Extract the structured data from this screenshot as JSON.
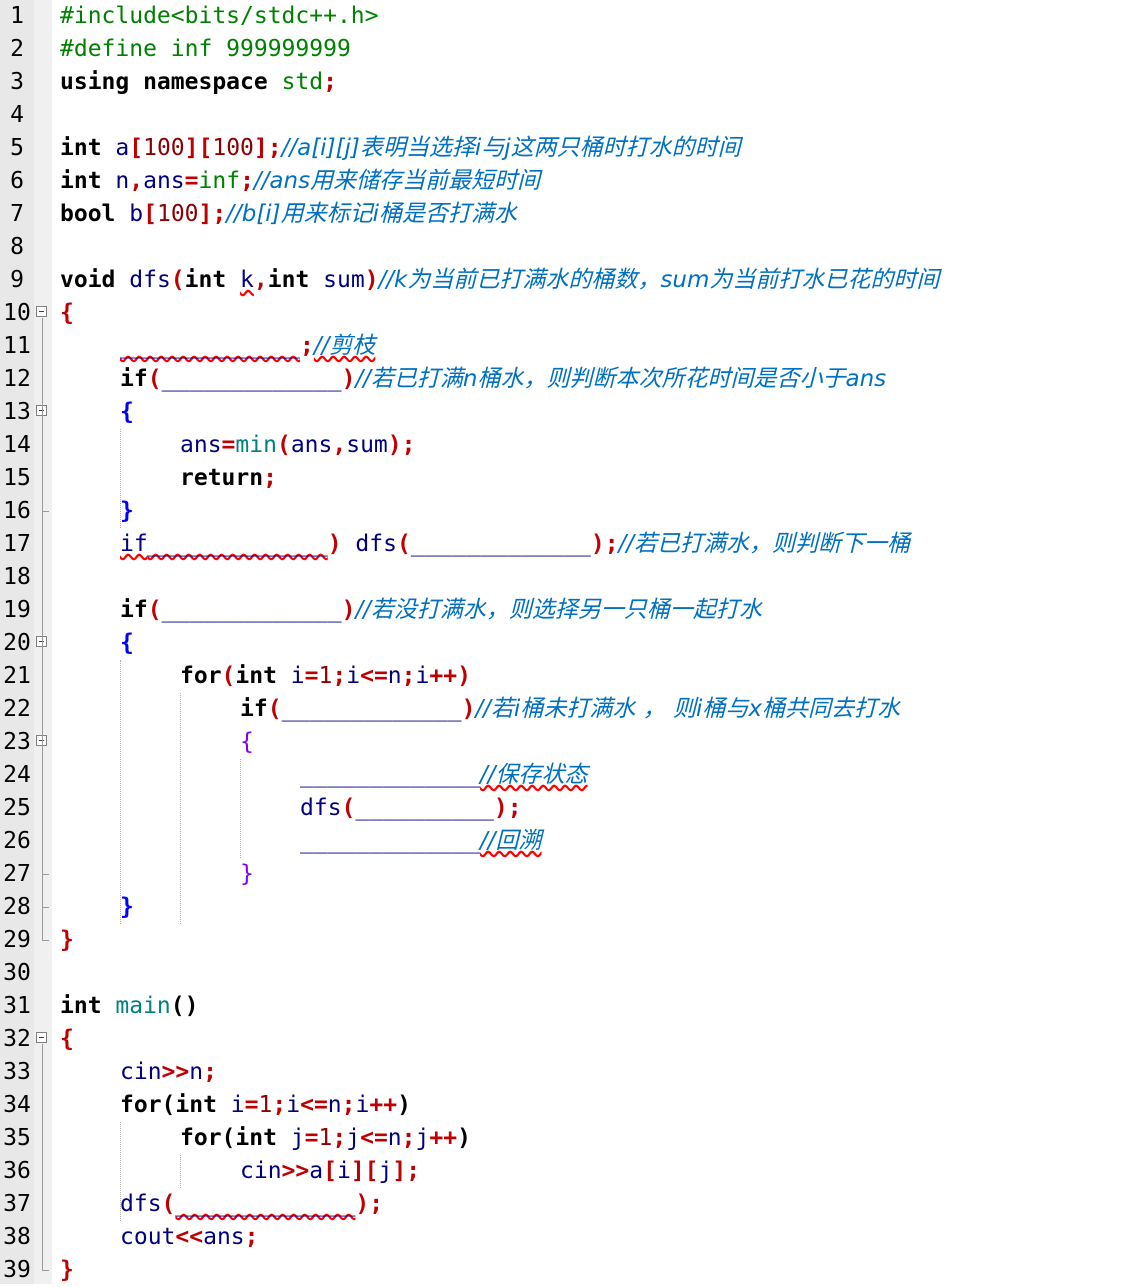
{
  "editor": {
    "lines": [
      {
        "n": "1",
        "indent": 0,
        "parts": [
          {
            "t": "#include<bits/stdc++.h>",
            "c": "pp"
          }
        ]
      },
      {
        "n": "2",
        "indent": 0,
        "parts": [
          {
            "t": "#define inf 999999999",
            "c": "pp"
          }
        ]
      },
      {
        "n": "3",
        "indent": 0,
        "parts": [
          {
            "t": "using namespace ",
            "c": "kw"
          },
          {
            "t": "std",
            "c": "pp"
          },
          {
            "t": ";",
            "c": "op"
          }
        ]
      },
      {
        "n": "4",
        "indent": 0,
        "parts": []
      },
      {
        "n": "5",
        "indent": 0,
        "parts": [
          {
            "t": "int ",
            "c": "kw"
          },
          {
            "t": "a",
            "c": "id"
          },
          {
            "t": "[",
            "c": "op"
          },
          {
            "t": "100",
            "c": "num"
          },
          {
            "t": "][",
            "c": "op"
          },
          {
            "t": "100",
            "c": "num"
          },
          {
            "t": "];",
            "c": "op"
          },
          {
            "t": "//a[i][j]表明当选择i与j这两只桶时打水的时间",
            "c": "cmt"
          }
        ]
      },
      {
        "n": "6",
        "indent": 0,
        "parts": [
          {
            "t": "int ",
            "c": "kw"
          },
          {
            "t": "n",
            "c": "id"
          },
          {
            "t": ",",
            "c": "op"
          },
          {
            "t": "ans",
            "c": "id"
          },
          {
            "t": "=",
            "c": "op"
          },
          {
            "t": "inf",
            "c": "pp"
          },
          {
            "t": ";",
            "c": "op"
          },
          {
            "t": "//ans用来储存当前最短时间",
            "c": "cmt"
          }
        ]
      },
      {
        "n": "7",
        "indent": 0,
        "parts": [
          {
            "t": "bool ",
            "c": "kw"
          },
          {
            "t": "b",
            "c": "id"
          },
          {
            "t": "[",
            "c": "op"
          },
          {
            "t": "100",
            "c": "num"
          },
          {
            "t": "];",
            "c": "op"
          },
          {
            "t": "//b[i]用来标记i桶是否打满水",
            "c": "cmt"
          }
        ]
      },
      {
        "n": "8",
        "indent": 0,
        "parts": []
      },
      {
        "n": "9",
        "indent": 0,
        "parts": [
          {
            "t": "void ",
            "c": "kw"
          },
          {
            "t": "dfs",
            "c": "id"
          },
          {
            "t": "(",
            "c": "op"
          },
          {
            "t": "int ",
            "c": "kw"
          },
          {
            "t": "k",
            "c": "id squig"
          },
          {
            "t": ",",
            "c": "op"
          },
          {
            "t": "int ",
            "c": "kw"
          },
          {
            "t": "sum",
            "c": "id"
          },
          {
            "t": ")",
            "c": "op"
          },
          {
            "t": "//k为当前已打满水的桶数，sum为当前打水已花的时间",
            "c": "cmt"
          }
        ]
      },
      {
        "n": "10",
        "indent": 0,
        "fold": true,
        "parts": [
          {
            "t": "{",
            "c": "brc"
          }
        ]
      },
      {
        "n": "11",
        "indent": 1,
        "parts": [
          {
            "t": "_____________",
            "c": "blank squig"
          },
          {
            "t": ";",
            "c": "op"
          },
          {
            "t": "//剪枝",
            "c": "cmt squig"
          }
        ]
      },
      {
        "n": "12",
        "indent": 1,
        "parts": [
          {
            "t": "if",
            "c": "kw"
          },
          {
            "t": "(",
            "c": "op"
          },
          {
            "t": "_____________",
            "c": "blank"
          },
          {
            "t": ")",
            "c": "op"
          },
          {
            "t": "//若已打满n桶水，则判断本次所花时间是否小于ans",
            "c": "cmt"
          }
        ]
      },
      {
        "n": "13",
        "indent": 1,
        "fold": true,
        "parts": [
          {
            "t": "{",
            "c": "br"
          }
        ]
      },
      {
        "n": "14",
        "indent": 2,
        "parts": [
          {
            "t": "ans",
            "c": "id"
          },
          {
            "t": "=",
            "c": "op"
          },
          {
            "t": "min",
            "c": "fn"
          },
          {
            "t": "(",
            "c": "op"
          },
          {
            "t": "ans",
            "c": "id"
          },
          {
            "t": ",",
            "c": "op"
          },
          {
            "t": "sum",
            "c": "id"
          },
          {
            "t": ");",
            "c": "op"
          }
        ]
      },
      {
        "n": "15",
        "indent": 2,
        "parts": [
          {
            "t": "return",
            "c": "kw"
          },
          {
            "t": ";",
            "c": "op"
          }
        ]
      },
      {
        "n": "16",
        "indent": 1,
        "parts": [
          {
            "t": "}",
            "c": "br"
          }
        ]
      },
      {
        "n": "17",
        "indent": 1,
        "parts": [
          {
            "t": "if",
            "c": "id squig"
          },
          {
            "t": "_____________",
            "c": "blank squig"
          },
          {
            "t": ") ",
            "c": "op"
          },
          {
            "t": "dfs",
            "c": "id"
          },
          {
            "t": "(",
            "c": "op"
          },
          {
            "t": "_____________",
            "c": "blank"
          },
          {
            "t": ");",
            "c": "op"
          },
          {
            "t": "//若已打满水，则判断下一桶",
            "c": "cmt"
          }
        ]
      },
      {
        "n": "18",
        "indent": 0,
        "parts": []
      },
      {
        "n": "19",
        "indent": 1,
        "parts": [
          {
            "t": "if",
            "c": "kw"
          },
          {
            "t": "(",
            "c": "op"
          },
          {
            "t": "_____________",
            "c": "blank"
          },
          {
            "t": ")",
            "c": "op"
          },
          {
            "t": "//若没打满水，则选择另一只桶一起打水",
            "c": "cmt"
          }
        ]
      },
      {
        "n": "20",
        "indent": 1,
        "fold": true,
        "parts": [
          {
            "t": "{",
            "c": "br"
          }
        ]
      },
      {
        "n": "21",
        "indent": 2,
        "parts": [
          {
            "t": "for",
            "c": "kw"
          },
          {
            "t": "(",
            "c": "op"
          },
          {
            "t": "int ",
            "c": "kw"
          },
          {
            "t": "i",
            "c": "id"
          },
          {
            "t": "=",
            "c": "op"
          },
          {
            "t": "1",
            "c": "num"
          },
          {
            "t": ";",
            "c": "op"
          },
          {
            "t": "i",
            "c": "id"
          },
          {
            "t": "<=",
            "c": "op"
          },
          {
            "t": "n",
            "c": "id"
          },
          {
            "t": ";",
            "c": "op"
          },
          {
            "t": "i",
            "c": "id"
          },
          {
            "t": "++)",
            "c": "op"
          }
        ]
      },
      {
        "n": "22",
        "indent": 3,
        "parts": [
          {
            "t": "if",
            "c": "kw"
          },
          {
            "t": "(",
            "c": "op"
          },
          {
            "t": "_____________",
            "c": "blank"
          },
          {
            "t": ")",
            "c": "op"
          },
          {
            "t": "//若i桶未打满水 ， 则i桶与x桶共同去打水",
            "c": "cmt"
          }
        ]
      },
      {
        "n": "23",
        "indent": 3,
        "fold": true,
        "parts": [
          {
            "t": "{",
            "c": "br2"
          }
        ]
      },
      {
        "n": "24",
        "indent": 4,
        "parts": [
          {
            "t": "_____________",
            "c": "blank"
          },
          {
            "t": "//保存状态",
            "c": "cmt squig"
          }
        ]
      },
      {
        "n": "25",
        "indent": 4,
        "parts": [
          {
            "t": "dfs",
            "c": "id"
          },
          {
            "t": "(",
            "c": "op"
          },
          {
            "t": "__________",
            "c": "blank"
          },
          {
            "t": ");",
            "c": "op"
          }
        ]
      },
      {
        "n": "26",
        "indent": 4,
        "parts": [
          {
            "t": "_____________",
            "c": "blank"
          },
          {
            "t": "//回溯",
            "c": "cmt squig"
          }
        ]
      },
      {
        "n": "27",
        "indent": 3,
        "parts": [
          {
            "t": "}",
            "c": "br2"
          }
        ]
      },
      {
        "n": "28",
        "indent": 1,
        "parts": [
          {
            "t": "}",
            "c": "br"
          }
        ]
      },
      {
        "n": "29",
        "indent": 0,
        "parts": [
          {
            "t": "}",
            "c": "brc"
          }
        ]
      },
      {
        "n": "30",
        "indent": 0,
        "parts": []
      },
      {
        "n": "31",
        "indent": 0,
        "parts": [
          {
            "t": "int ",
            "c": "kw"
          },
          {
            "t": "main",
            "c": "fn"
          },
          {
            "t": "()",
            "c": "kw"
          }
        ]
      },
      {
        "n": "32",
        "indent": 0,
        "fold": true,
        "parts": [
          {
            "t": "{",
            "c": "brc"
          }
        ]
      },
      {
        "n": "33",
        "indent": 1,
        "parts": [
          {
            "t": "cin",
            "c": "id"
          },
          {
            "t": ">>",
            "c": "op"
          },
          {
            "t": "n",
            "c": "id"
          },
          {
            "t": ";",
            "c": "op"
          }
        ]
      },
      {
        "n": "34",
        "indent": 1,
        "parts": [
          {
            "t": "for",
            "c": "kw"
          },
          {
            "t": "(",
            "c": "kw"
          },
          {
            "t": "int ",
            "c": "kw"
          },
          {
            "t": "i",
            "c": "id"
          },
          {
            "t": "=",
            "c": "op"
          },
          {
            "t": "1",
            "c": "num"
          },
          {
            "t": ";",
            "c": "op"
          },
          {
            "t": "i",
            "c": "id"
          },
          {
            "t": "<=",
            "c": "op"
          },
          {
            "t": "n",
            "c": "id"
          },
          {
            "t": ";",
            "c": "op"
          },
          {
            "t": "i",
            "c": "id"
          },
          {
            "t": "++",
            "c": "op"
          },
          {
            "t": ")",
            "c": "kw"
          }
        ]
      },
      {
        "n": "35",
        "indent": 2,
        "parts": [
          {
            "t": "for",
            "c": "kw"
          },
          {
            "t": "(",
            "c": "kw"
          },
          {
            "t": "int ",
            "c": "kw"
          },
          {
            "t": "j",
            "c": "id"
          },
          {
            "t": "=",
            "c": "op"
          },
          {
            "t": "1",
            "c": "num"
          },
          {
            "t": ";",
            "c": "op"
          },
          {
            "t": "j",
            "c": "id"
          },
          {
            "t": "<=",
            "c": "op"
          },
          {
            "t": "n",
            "c": "id"
          },
          {
            "t": ";",
            "c": "op"
          },
          {
            "t": "j",
            "c": "id"
          },
          {
            "t": "++",
            "c": "op"
          },
          {
            "t": ")",
            "c": "kw"
          }
        ]
      },
      {
        "n": "36",
        "indent": 3,
        "parts": [
          {
            "t": "cin",
            "c": "id"
          },
          {
            "t": ">>",
            "c": "op"
          },
          {
            "t": "a",
            "c": "id"
          },
          {
            "t": "[",
            "c": "op"
          },
          {
            "t": "i",
            "c": "id"
          },
          {
            "t": "][",
            "c": "op"
          },
          {
            "t": "j",
            "c": "id"
          },
          {
            "t": "];",
            "c": "op"
          }
        ]
      },
      {
        "n": "37",
        "indent": 1,
        "parts": [
          {
            "t": "dfs",
            "c": "id"
          },
          {
            "t": "(",
            "c": "op"
          },
          {
            "t": "_____________",
            "c": "blank squig"
          },
          {
            "t": ");",
            "c": "op"
          }
        ]
      },
      {
        "n": "38",
        "indent": 1,
        "parts": [
          {
            "t": "cout",
            "c": "id"
          },
          {
            "t": "<<",
            "c": "op"
          },
          {
            "t": "ans",
            "c": "id"
          },
          {
            "t": ";",
            "c": "op"
          }
        ]
      },
      {
        "n": "39",
        "indent": 0,
        "parts": [
          {
            "t": "}",
            "c": "brc"
          }
        ]
      }
    ]
  }
}
